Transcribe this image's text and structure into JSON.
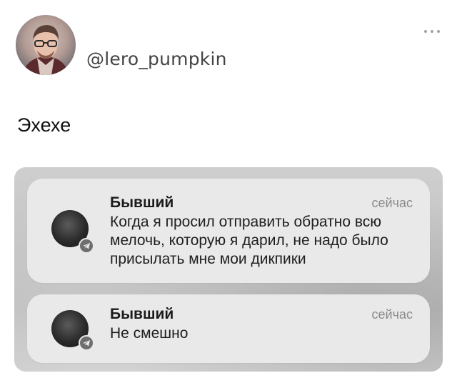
{
  "post": {
    "username": "@lero_pumpkin",
    "text": "Эхехе",
    "more_icon": "more-horizontal-icon"
  },
  "notifications": [
    {
      "sender": "Бывший",
      "time": "сейчас",
      "message": "Когда я просил отправить обратно всю мелочь, которую я дарил, не надо было присылать мне мои дикпики",
      "app_icon": "telegram-icon"
    },
    {
      "sender": "Бывший",
      "time": "сейчас",
      "message": "Не смешно",
      "app_icon": "telegram-icon"
    }
  ],
  "colors": {
    "notification_bg": "#e9e9e9",
    "muted_text": "#8a8a8a",
    "username_text": "#444444"
  }
}
